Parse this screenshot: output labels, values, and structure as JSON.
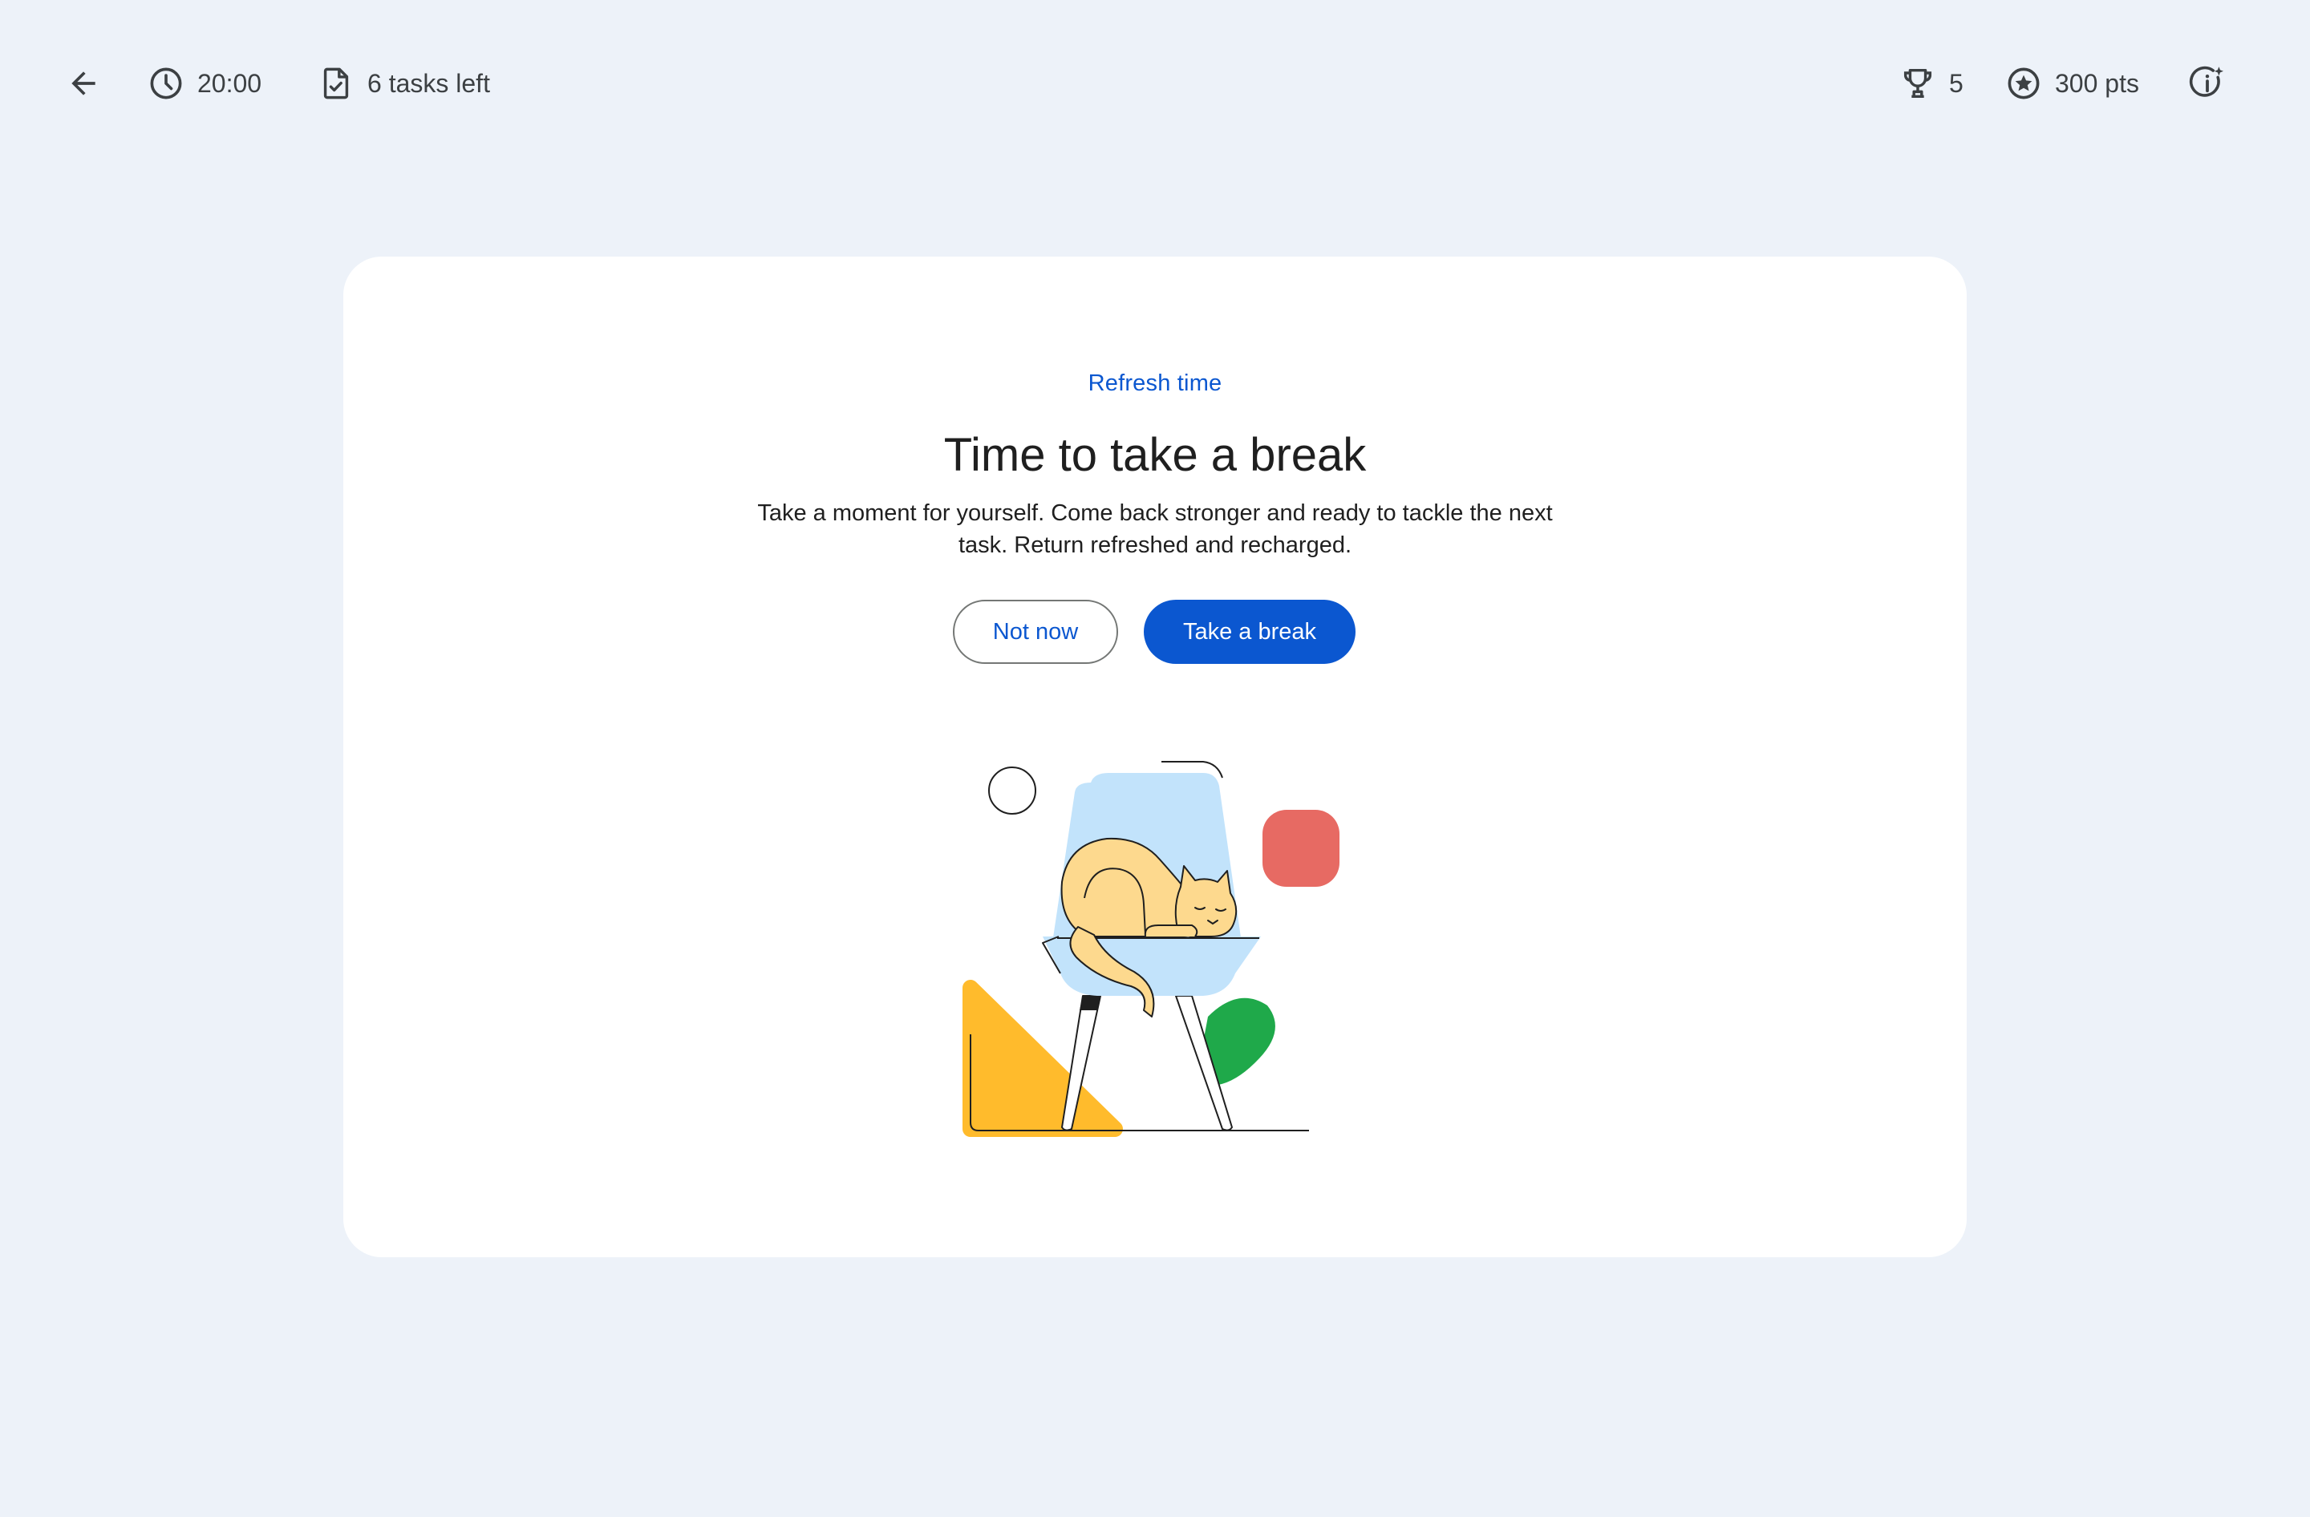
{
  "topbar": {
    "back_icon": "arrow-left-icon",
    "timer": {
      "icon": "clock-icon",
      "value": "20:00"
    },
    "tasks": {
      "icon": "task-document-icon",
      "label": "6 tasks left"
    },
    "trophies": {
      "icon": "trophy-icon",
      "value": "5"
    },
    "points": {
      "icon": "star-circle-icon",
      "label": "300 pts"
    },
    "info_icon": "info-sparkle-icon"
  },
  "card": {
    "eyebrow": "Refresh time",
    "title": "Time to take a break",
    "description": "Take a moment for yourself. Come back stronger and ready to tackle the next task. Return refreshed and recharged.",
    "secondary_button": "Not now",
    "primary_button": "Take a break",
    "illustration": "cat-sleeping-on-chair-illustration"
  },
  "colors": {
    "background": "#edf2f9",
    "card": "#ffffff",
    "accent": "#0b57d0",
    "chair": "#c2e3fb",
    "cat": "#fdd98e",
    "red_shape": "#e76a63",
    "yellow_shape": "#ffbb2c",
    "green_shape": "#1fa94a"
  }
}
